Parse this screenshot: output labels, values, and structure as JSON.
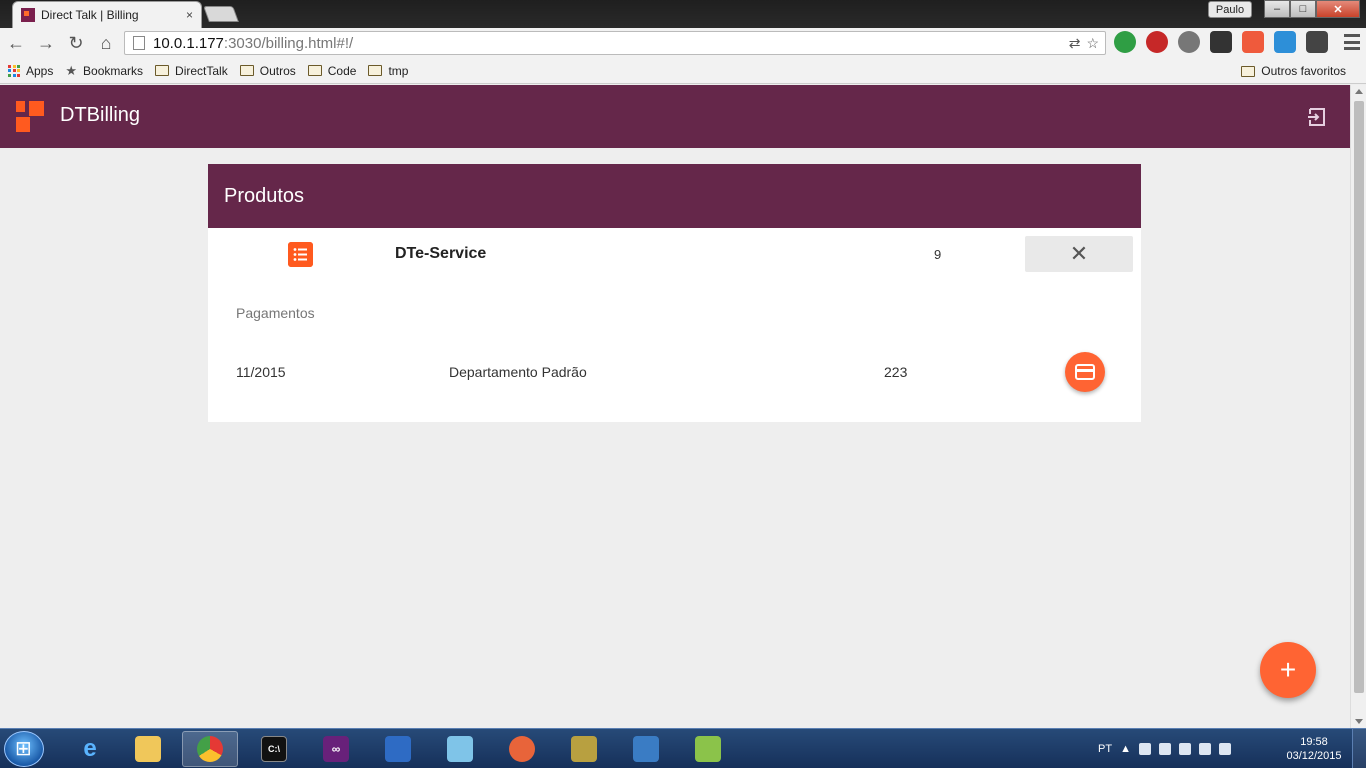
{
  "browser": {
    "tab_title": "Direct Talk | Billing",
    "tab_close": "×",
    "user_name": "Paulo",
    "url_host": "10.0.1.177",
    "url_rest": ":3030/billing.html#!/",
    "window_controls": {
      "minimize": "–",
      "maximize": "□",
      "close": "✕"
    },
    "nav": {
      "back": "←",
      "forward": "→",
      "reload": "↻",
      "home": "⌂"
    }
  },
  "bookmarks": {
    "items": [
      {
        "label": "Apps"
      },
      {
        "label": "Bookmarks"
      },
      {
        "label": "DirectTalk"
      },
      {
        "label": "Outros"
      },
      {
        "label": "Code"
      },
      {
        "label": "tmp"
      }
    ],
    "other": "Outros favoritos"
  },
  "app": {
    "title": "DTBilling",
    "brand_color": "#65274a",
    "accent_color": "#ff5a1f"
  },
  "card": {
    "title": "Produtos",
    "product": {
      "name": "DTe-Service",
      "count": "9",
      "remove_label": "✕"
    },
    "payments_label": "Pagamentos",
    "payments": [
      {
        "date": "11/2015",
        "department": "Departamento Padrão",
        "value": "223"
      }
    ]
  },
  "fab": {
    "label": "+"
  },
  "taskbar": {
    "language": "PT",
    "time": "19:58",
    "date": "03/12/2015"
  }
}
